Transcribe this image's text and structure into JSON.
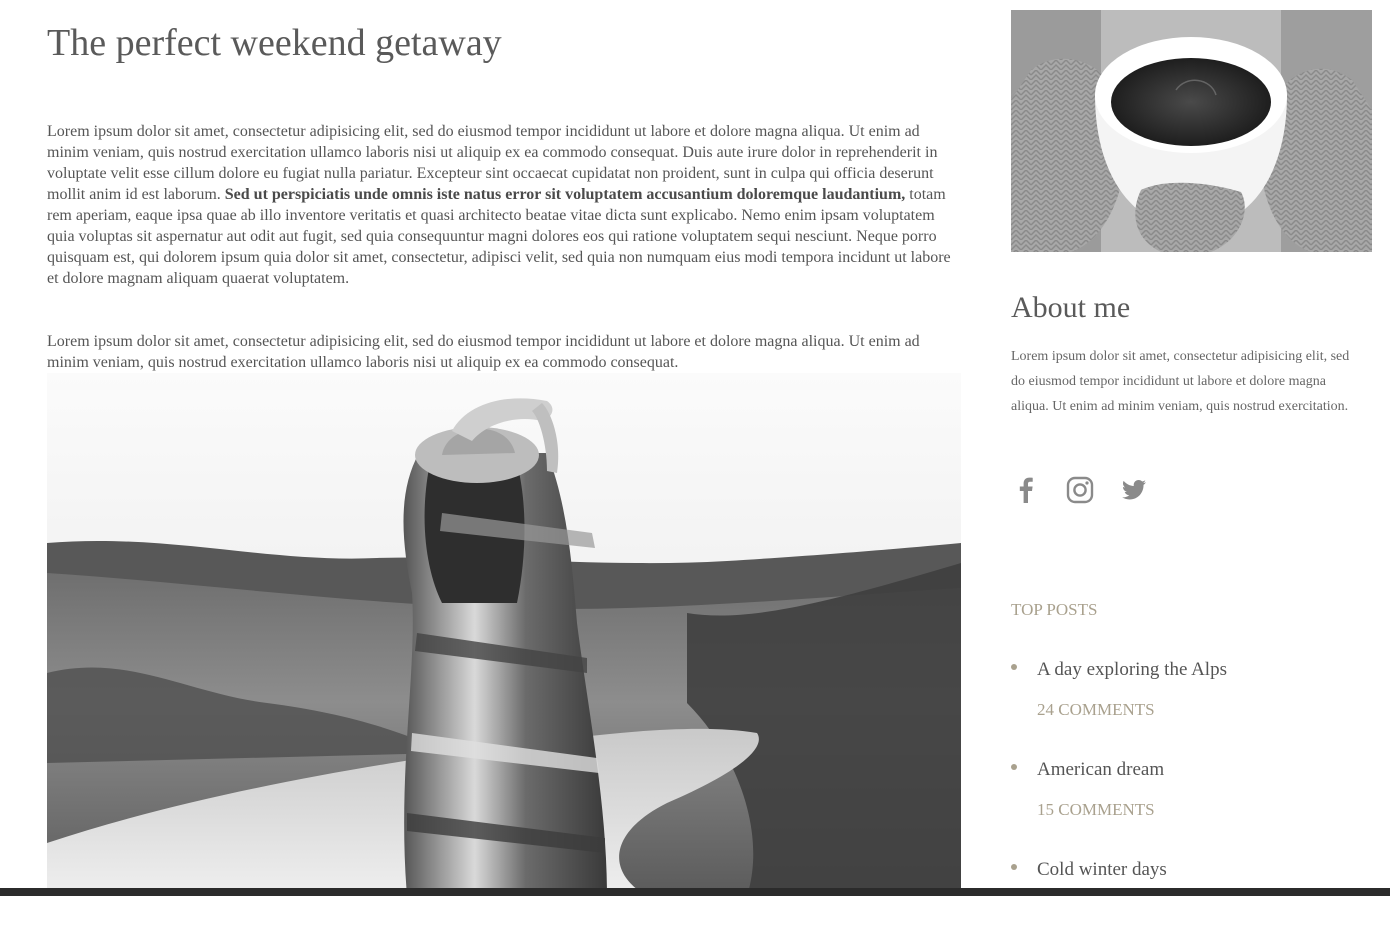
{
  "post": {
    "title": "The perfect weekend getaway",
    "para1_a": "Lorem ipsum dolor sit amet, consectetur adipisicing elit, sed do eiusmod tempor incididunt ut labore et dolore magna aliqua. Ut enim ad minim veniam, quis nostrud exercitation ullamco laboris nisi ut aliquip ex ea commodo consequat. Duis aute irure dolor in reprehenderit in voluptate velit esse cillum dolore eu fugiat nulla pariatur. Excepteur sint occaecat cupidatat non proident, sunt in culpa qui officia deserunt mollit anim id est laborum. ",
    "para1_bold": "Sed ut perspiciatis unde omnis iste natus error sit voluptatem accusantium doloremque laudantium,",
    "para1_b": " totam rem aperiam, eaque ipsa quae ab illo inventore veritatis et quasi architecto beatae vitae dicta sunt explicabo. Nemo enim ipsam voluptatem quia voluptas sit aspernatur aut odit aut fugit, sed quia consequuntur magni dolores eos qui ratione voluptatem sequi nesciunt. Neque porro quisquam est, qui dolorem ipsum quia dolor sit amet, consectetur, adipisci velit, sed quia non numquam eius modi tempora incidunt ut labore et dolore magnam aliquam quaerat voluptatem.",
    "para2": "Lorem ipsum dolor sit amet, consectetur adipisicing elit, sed do eiusmod tempor incididunt ut labore et dolore magna aliqua. Ut enim ad minim veniam, quis nostrud exercitation ullamco laboris nisi ut aliquip ex ea commodo consequat."
  },
  "sidebar": {
    "about_title": "About me",
    "about_text": "Lorem ipsum dolor sit amet, consectetur adipisicing elit, sed do eiusmod tempor incididunt ut labore et dolore magna aliqua. Ut enim ad minim veniam, quis nostrud exercitation.",
    "social_icons": [
      "facebook-icon",
      "instagram-icon",
      "twitter-icon"
    ],
    "top_posts_heading": "TOP POSTS",
    "top_posts": [
      {
        "title": "A day exploring the Alps",
        "comments": "24 COMMENTS"
      },
      {
        "title": "American dream",
        "comments": "15 COMMENTS"
      },
      {
        "title": "Cold winter days",
        "comments": ""
      }
    ]
  },
  "colors": {
    "accent": "#a9a18e",
    "text": "#555555",
    "heading": "#5a5a5a",
    "bottom_bar": "#2b2b2b"
  }
}
